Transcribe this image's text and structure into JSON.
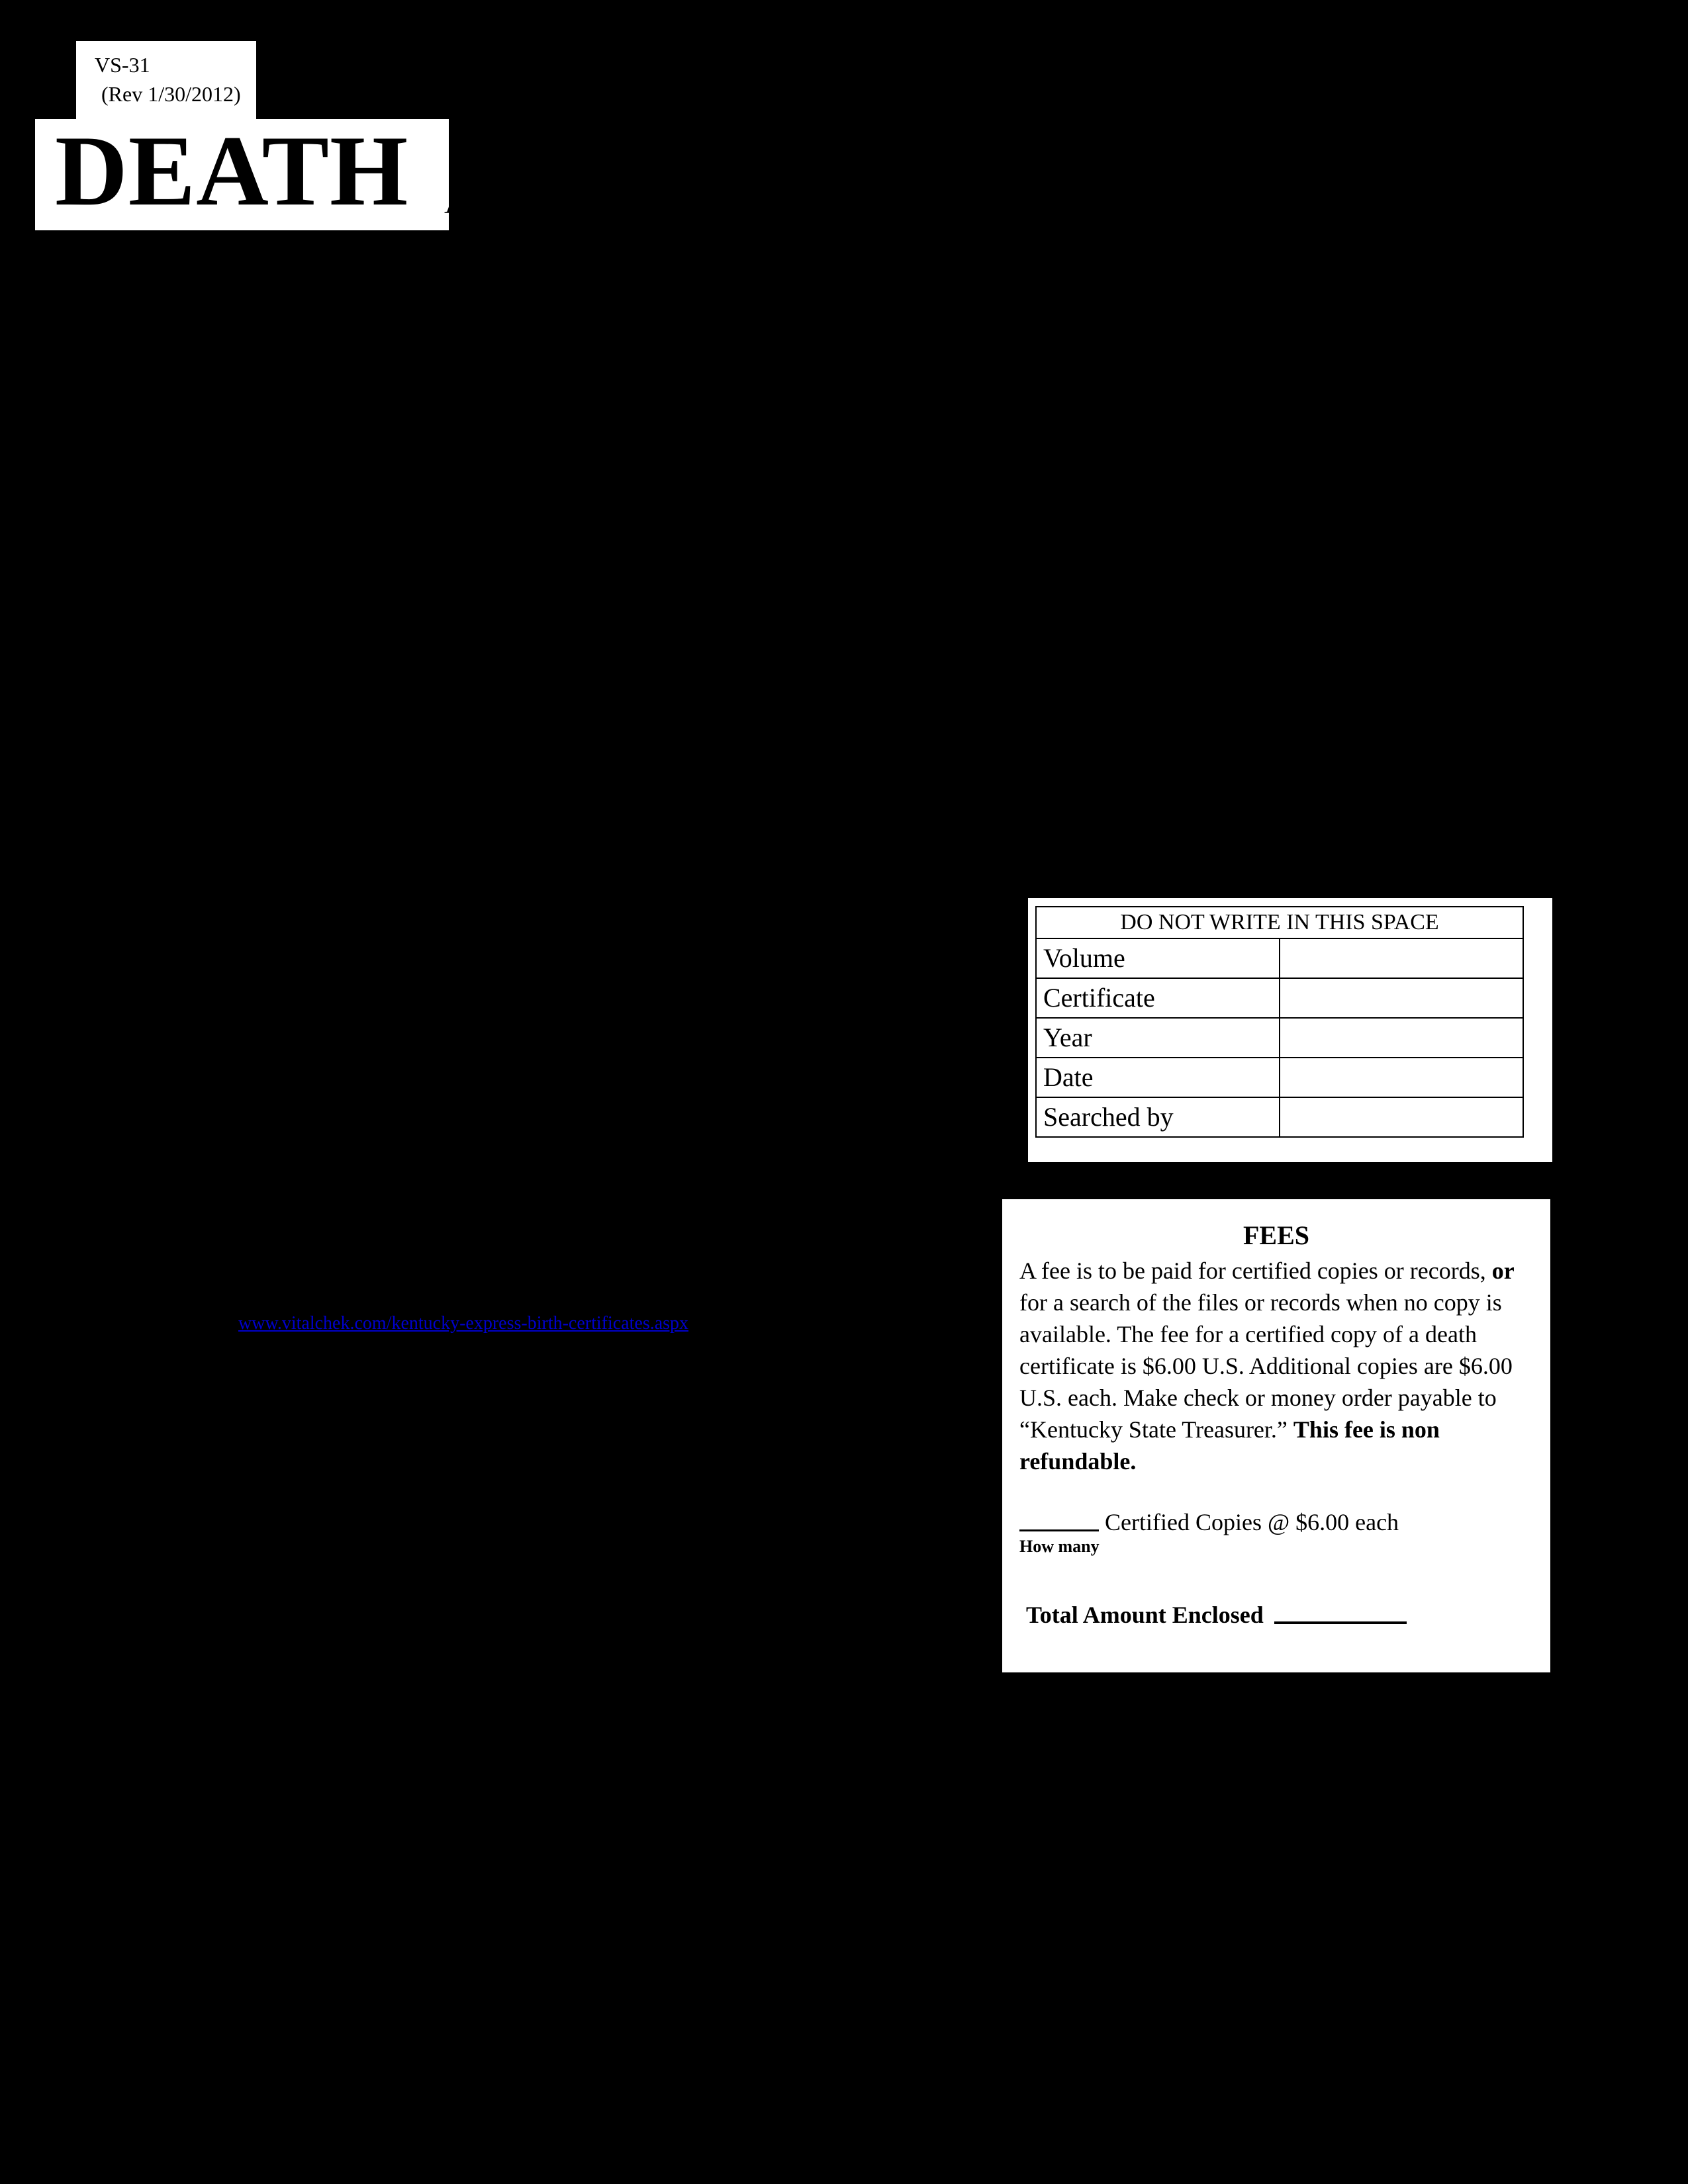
{
  "document": {
    "form_number": "VS-31",
    "revision": "(Rev 1/30/2012)",
    "title_word": "DEATH",
    "title_word_continuation": "AP"
  },
  "link": {
    "vitalchek_url": "www.vitalchek.com/kentucky-express-birth-certificates.aspx"
  },
  "office_use": {
    "header": "DO NOT WRITE IN THIS SPACE",
    "rows": [
      {
        "label": "Volume",
        "value": ""
      },
      {
        "label": "Certificate",
        "value": ""
      },
      {
        "label": "Year",
        "value": ""
      },
      {
        "label": "Date",
        "value": ""
      },
      {
        "label": "Searched by",
        "value": ""
      }
    ]
  },
  "fees": {
    "heading": "FEES",
    "paragraph_part1": "A fee is to be paid for certified copies or records, ",
    "paragraph_or": "or",
    "paragraph_part2": " for a search of the files or records when no copy is available.  The fee for a certified copy of a death certificate is $6.00 U.S.  Additional copies are $6.00 U.S. each. Make check or money order payable to “Kentucky State Treasurer.” ",
    "paragraph_bold_tail": "This fee is non refundable.",
    "copies_line": "Certified Copies @ $6.00 each",
    "how_many_label": "How many",
    "total_label": "Total Amount Enclosed"
  },
  "colors": {
    "page_background": "#000000",
    "panel_background": "#ffffff",
    "text": "#000000",
    "link": "#0000cc"
  }
}
